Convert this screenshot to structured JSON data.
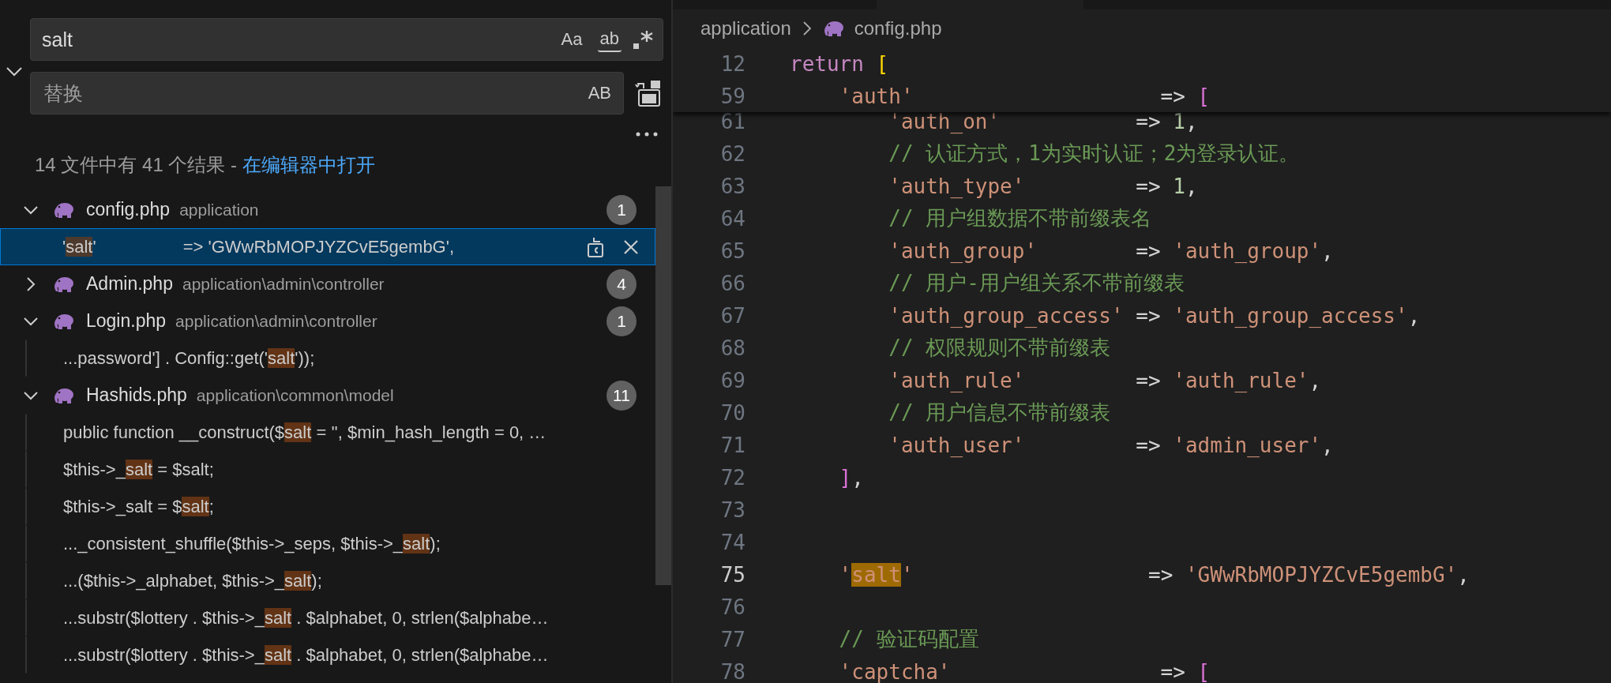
{
  "search": {
    "value": "salt",
    "toggles": [
      {
        "label": "Aa",
        "on": false
      },
      {
        "label": "ab",
        "on": false
      }
    ]
  },
  "replace": {
    "placeholder": "替换",
    "toggle": {
      "label": "AB",
      "on": false
    }
  },
  "summary": {
    "text": "14 文件中有 41 个结果 - ",
    "link": "在编辑器中打开"
  },
  "results": [
    {
      "name": "config.php",
      "path": "application",
      "count": "1",
      "expanded": true,
      "matches": [
        {
          "before": "'",
          "hit": "salt",
          "after": "'                  => 'GWwRbMOPJYZCvE5gembG',",
          "selected": true
        }
      ]
    },
    {
      "name": "Admin.php",
      "path": "application\\admin\\controller",
      "count": "4",
      "expanded": false
    },
    {
      "name": "Login.php",
      "path": "application\\admin\\controller",
      "count": "1",
      "expanded": true,
      "matches": [
        {
          "before": "...password'] . Config::get('",
          "hit": "salt",
          "after": "'));",
          "selected": false
        }
      ]
    },
    {
      "name": "Hashids.php",
      "path": "application\\common\\model",
      "count": "11",
      "expanded": true,
      "matches": [
        {
          "before": "public function __construct($",
          "hit": "salt",
          "after": " = '', $min_hash_length = 0, …",
          "selected": false
        },
        {
          "before": "$this->_",
          "hit": "salt",
          "after": " = $salt;",
          "selected": false
        },
        {
          "before": "$this->_salt = $",
          "hit": "salt",
          "after": ";",
          "selected": false
        },
        {
          "before": "..._consistent_shuffle($this->_seps, $this->_",
          "hit": "salt",
          "after": ");",
          "selected": false
        },
        {
          "before": "...($this->_alphabet, $this->_",
          "hit": "salt",
          "after": ");",
          "selected": false
        },
        {
          "before": "...substr($lottery . $this->_",
          "hit": "salt",
          "after": " . $alphabet, 0, strlen($alphabe…",
          "selected": false
        },
        {
          "before": "...substr($lottery . $this->_",
          "hit": "salt",
          "after": " . $alphabet, 0, strlen($alphabe…",
          "selected": false
        }
      ]
    }
  ],
  "breadcrumb": {
    "folder": "application",
    "file": "config.php"
  },
  "sticky_lines": [
    {
      "num": "12",
      "current": false,
      "tokens": [
        {
          "kind": "keyword",
          "text": "return "
        },
        {
          "kind": "bracket1",
          "text": "["
        }
      ]
    },
    {
      "num": "59",
      "current": false,
      "tokens": [
        {
          "kind": "string",
          "text": "    'auth'"
        },
        {
          "kind": "plain",
          "text": "                    => "
        },
        {
          "kind": "bracket2",
          "text": "["
        }
      ]
    }
  ],
  "lines": [
    {
      "num": "61",
      "current": false,
      "tokens": [
        {
          "kind": "string",
          "text": "        'auth_on'"
        },
        {
          "kind": "plain",
          "text": "           => "
        },
        {
          "kind": "number",
          "text": "1"
        },
        {
          "kind": "plain",
          "text": ","
        }
      ]
    },
    {
      "num": "62",
      "current": false,
      "tokens": [
        {
          "kind": "comment",
          "text": "        // 认证方式，1为实时认证；2为登录认证。"
        }
      ]
    },
    {
      "num": "63",
      "current": false,
      "tokens": [
        {
          "kind": "string",
          "text": "        'auth_type'"
        },
        {
          "kind": "plain",
          "text": "         => "
        },
        {
          "kind": "number",
          "text": "1"
        },
        {
          "kind": "plain",
          "text": ","
        }
      ]
    },
    {
      "num": "64",
      "current": false,
      "tokens": [
        {
          "kind": "comment",
          "text": "        // 用户组数据不带前缀表名"
        }
      ]
    },
    {
      "num": "65",
      "current": false,
      "tokens": [
        {
          "kind": "string",
          "text": "        'auth_group'"
        },
        {
          "kind": "plain",
          "text": "        => "
        },
        {
          "kind": "string",
          "text": "'auth_group'"
        },
        {
          "kind": "plain",
          "text": ","
        }
      ]
    },
    {
      "num": "66",
      "current": false,
      "tokens": [
        {
          "kind": "comment",
          "text": "        // 用户-用户组关系不带前缀表"
        }
      ]
    },
    {
      "num": "67",
      "current": false,
      "tokens": [
        {
          "kind": "string",
          "text": "        'auth_group_access'"
        },
        {
          "kind": "plain",
          "text": " => "
        },
        {
          "kind": "string",
          "text": "'auth_group_access'"
        },
        {
          "kind": "plain",
          "text": ","
        }
      ]
    },
    {
      "num": "68",
      "current": false,
      "tokens": [
        {
          "kind": "comment",
          "text": "        // 权限规则不带前缀表"
        }
      ]
    },
    {
      "num": "69",
      "current": false,
      "tokens": [
        {
          "kind": "string",
          "text": "        'auth_rule'"
        },
        {
          "kind": "plain",
          "text": "         => "
        },
        {
          "kind": "string",
          "text": "'auth_rule'"
        },
        {
          "kind": "plain",
          "text": ","
        }
      ]
    },
    {
      "num": "70",
      "current": false,
      "tokens": [
        {
          "kind": "comment",
          "text": "        // 用户信息不带前缀表"
        }
      ]
    },
    {
      "num": "71",
      "current": false,
      "tokens": [
        {
          "kind": "string",
          "text": "        'auth_user'"
        },
        {
          "kind": "plain",
          "text": "         => "
        },
        {
          "kind": "string",
          "text": "'admin_user'"
        },
        {
          "kind": "plain",
          "text": ","
        }
      ]
    },
    {
      "num": "72",
      "current": false,
      "tokens": [
        {
          "kind": "bracket2",
          "text": "    ]"
        },
        {
          "kind": "plain",
          "text": ","
        }
      ]
    },
    {
      "num": "73",
      "current": false
    },
    {
      "num": "74",
      "current": false
    },
    {
      "num": "75",
      "current": true,
      "tokens": [
        {
          "kind": "string",
          "text": "    '"
        },
        {
          "kind": "hit",
          "text": "salt"
        },
        {
          "kind": "string",
          "text": "'"
        },
        {
          "kind": "plain",
          "text": "                   => "
        },
        {
          "kind": "string",
          "text": "'GWwRbMOPJYZCvE5gembG'"
        },
        {
          "kind": "plain",
          "text": ","
        }
      ]
    },
    {
      "num": "76",
      "current": false
    },
    {
      "num": "77",
      "current": false,
      "tokens": [
        {
          "kind": "comment",
          "text": "    // 验证码配置"
        }
      ]
    },
    {
      "num": "78",
      "current": false,
      "tokens": [
        {
          "kind": "string",
          "text": "    'captcha'"
        },
        {
          "kind": "plain",
          "text": "                 => "
        },
        {
          "kind": "bracket2",
          "text": "["
        }
      ]
    }
  ]
}
